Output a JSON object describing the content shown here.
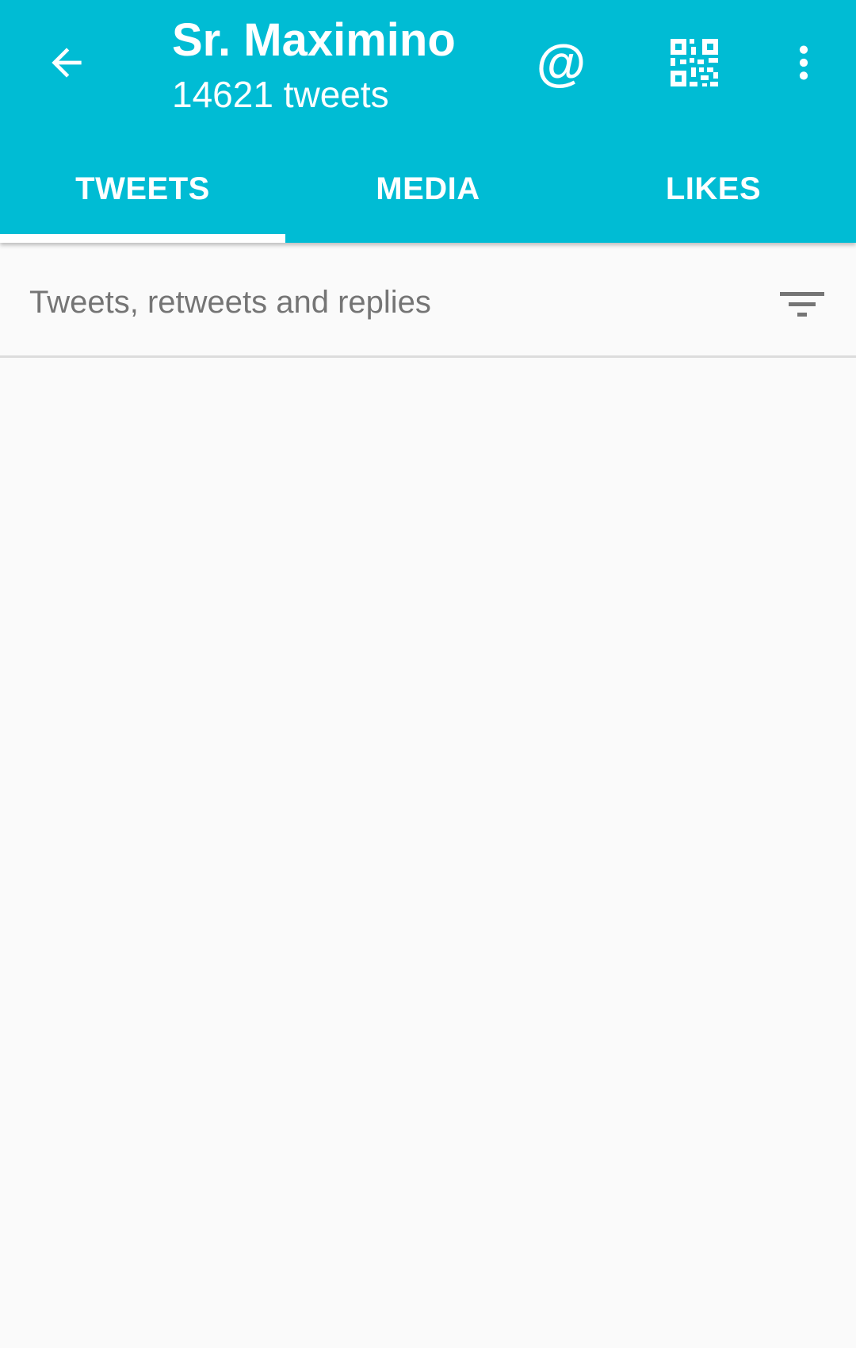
{
  "profile": {
    "name": "Sr. Maximino",
    "tweet_count": "14621 tweets"
  },
  "toolbar": {
    "back_icon": "arrow-back-icon",
    "mention_icon": "at-icon",
    "mention_glyph": "@",
    "qr_icon": "qr-code-icon",
    "more_icon": "more-vert-icon"
  },
  "tabs": [
    {
      "label": "TWEETS",
      "selected": true
    },
    {
      "label": "MEDIA",
      "selected": false
    },
    {
      "label": "LIKES",
      "selected": false
    }
  ],
  "filter": {
    "label": "Tweets, retweets and replies",
    "icon": "filter-list-icon"
  },
  "colors": {
    "accent": "#00bcd4",
    "on_accent": "#ffffff",
    "background": "#fafafa",
    "secondary_text": "#757575"
  }
}
